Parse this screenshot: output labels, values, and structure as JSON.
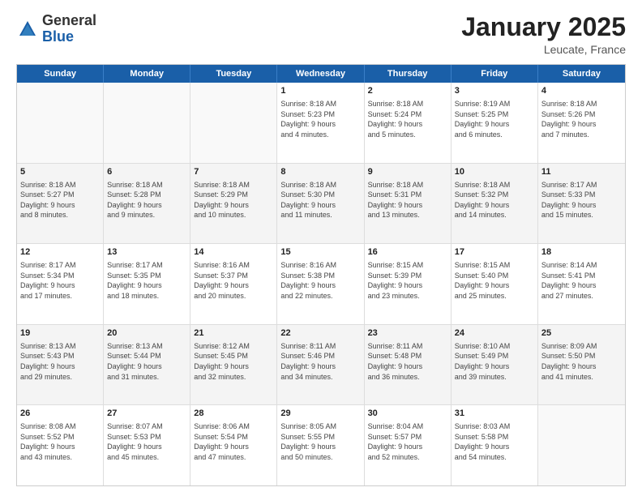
{
  "header": {
    "logo_general": "General",
    "logo_blue": "Blue",
    "title": "January 2025",
    "subtitle": "Leucate, France"
  },
  "weekdays": [
    "Sunday",
    "Monday",
    "Tuesday",
    "Wednesday",
    "Thursday",
    "Friday",
    "Saturday"
  ],
  "weeks": [
    {
      "alt": false,
      "days": [
        {
          "num": "",
          "lines": []
        },
        {
          "num": "",
          "lines": []
        },
        {
          "num": "",
          "lines": []
        },
        {
          "num": "1",
          "lines": [
            "Sunrise: 8:18 AM",
            "Sunset: 5:23 PM",
            "Daylight: 9 hours",
            "and 4 minutes."
          ]
        },
        {
          "num": "2",
          "lines": [
            "Sunrise: 8:18 AM",
            "Sunset: 5:24 PM",
            "Daylight: 9 hours",
            "and 5 minutes."
          ]
        },
        {
          "num": "3",
          "lines": [
            "Sunrise: 8:19 AM",
            "Sunset: 5:25 PM",
            "Daylight: 9 hours",
            "and 6 minutes."
          ]
        },
        {
          "num": "4",
          "lines": [
            "Sunrise: 8:18 AM",
            "Sunset: 5:26 PM",
            "Daylight: 9 hours",
            "and 7 minutes."
          ]
        }
      ]
    },
    {
      "alt": true,
      "days": [
        {
          "num": "5",
          "lines": [
            "Sunrise: 8:18 AM",
            "Sunset: 5:27 PM",
            "Daylight: 9 hours",
            "and 8 minutes."
          ]
        },
        {
          "num": "6",
          "lines": [
            "Sunrise: 8:18 AM",
            "Sunset: 5:28 PM",
            "Daylight: 9 hours",
            "and 9 minutes."
          ]
        },
        {
          "num": "7",
          "lines": [
            "Sunrise: 8:18 AM",
            "Sunset: 5:29 PM",
            "Daylight: 9 hours",
            "and 10 minutes."
          ]
        },
        {
          "num": "8",
          "lines": [
            "Sunrise: 8:18 AM",
            "Sunset: 5:30 PM",
            "Daylight: 9 hours",
            "and 11 minutes."
          ]
        },
        {
          "num": "9",
          "lines": [
            "Sunrise: 8:18 AM",
            "Sunset: 5:31 PM",
            "Daylight: 9 hours",
            "and 13 minutes."
          ]
        },
        {
          "num": "10",
          "lines": [
            "Sunrise: 8:18 AM",
            "Sunset: 5:32 PM",
            "Daylight: 9 hours",
            "and 14 minutes."
          ]
        },
        {
          "num": "11",
          "lines": [
            "Sunrise: 8:17 AM",
            "Sunset: 5:33 PM",
            "Daylight: 9 hours",
            "and 15 minutes."
          ]
        }
      ]
    },
    {
      "alt": false,
      "days": [
        {
          "num": "12",
          "lines": [
            "Sunrise: 8:17 AM",
            "Sunset: 5:34 PM",
            "Daylight: 9 hours",
            "and 17 minutes."
          ]
        },
        {
          "num": "13",
          "lines": [
            "Sunrise: 8:17 AM",
            "Sunset: 5:35 PM",
            "Daylight: 9 hours",
            "and 18 minutes."
          ]
        },
        {
          "num": "14",
          "lines": [
            "Sunrise: 8:16 AM",
            "Sunset: 5:37 PM",
            "Daylight: 9 hours",
            "and 20 minutes."
          ]
        },
        {
          "num": "15",
          "lines": [
            "Sunrise: 8:16 AM",
            "Sunset: 5:38 PM",
            "Daylight: 9 hours",
            "and 22 minutes."
          ]
        },
        {
          "num": "16",
          "lines": [
            "Sunrise: 8:15 AM",
            "Sunset: 5:39 PM",
            "Daylight: 9 hours",
            "and 23 minutes."
          ]
        },
        {
          "num": "17",
          "lines": [
            "Sunrise: 8:15 AM",
            "Sunset: 5:40 PM",
            "Daylight: 9 hours",
            "and 25 minutes."
          ]
        },
        {
          "num": "18",
          "lines": [
            "Sunrise: 8:14 AM",
            "Sunset: 5:41 PM",
            "Daylight: 9 hours",
            "and 27 minutes."
          ]
        }
      ]
    },
    {
      "alt": true,
      "days": [
        {
          "num": "19",
          "lines": [
            "Sunrise: 8:13 AM",
            "Sunset: 5:43 PM",
            "Daylight: 9 hours",
            "and 29 minutes."
          ]
        },
        {
          "num": "20",
          "lines": [
            "Sunrise: 8:13 AM",
            "Sunset: 5:44 PM",
            "Daylight: 9 hours",
            "and 31 minutes."
          ]
        },
        {
          "num": "21",
          "lines": [
            "Sunrise: 8:12 AM",
            "Sunset: 5:45 PM",
            "Daylight: 9 hours",
            "and 32 minutes."
          ]
        },
        {
          "num": "22",
          "lines": [
            "Sunrise: 8:11 AM",
            "Sunset: 5:46 PM",
            "Daylight: 9 hours",
            "and 34 minutes."
          ]
        },
        {
          "num": "23",
          "lines": [
            "Sunrise: 8:11 AM",
            "Sunset: 5:48 PM",
            "Daylight: 9 hours",
            "and 36 minutes."
          ]
        },
        {
          "num": "24",
          "lines": [
            "Sunrise: 8:10 AM",
            "Sunset: 5:49 PM",
            "Daylight: 9 hours",
            "and 39 minutes."
          ]
        },
        {
          "num": "25",
          "lines": [
            "Sunrise: 8:09 AM",
            "Sunset: 5:50 PM",
            "Daylight: 9 hours",
            "and 41 minutes."
          ]
        }
      ]
    },
    {
      "alt": false,
      "days": [
        {
          "num": "26",
          "lines": [
            "Sunrise: 8:08 AM",
            "Sunset: 5:52 PM",
            "Daylight: 9 hours",
            "and 43 minutes."
          ]
        },
        {
          "num": "27",
          "lines": [
            "Sunrise: 8:07 AM",
            "Sunset: 5:53 PM",
            "Daylight: 9 hours",
            "and 45 minutes."
          ]
        },
        {
          "num": "28",
          "lines": [
            "Sunrise: 8:06 AM",
            "Sunset: 5:54 PM",
            "Daylight: 9 hours",
            "and 47 minutes."
          ]
        },
        {
          "num": "29",
          "lines": [
            "Sunrise: 8:05 AM",
            "Sunset: 5:55 PM",
            "Daylight: 9 hours",
            "and 50 minutes."
          ]
        },
        {
          "num": "30",
          "lines": [
            "Sunrise: 8:04 AM",
            "Sunset: 5:57 PM",
            "Daylight: 9 hours",
            "and 52 minutes."
          ]
        },
        {
          "num": "31",
          "lines": [
            "Sunrise: 8:03 AM",
            "Sunset: 5:58 PM",
            "Daylight: 9 hours",
            "and 54 minutes."
          ]
        },
        {
          "num": "",
          "lines": []
        }
      ]
    }
  ]
}
